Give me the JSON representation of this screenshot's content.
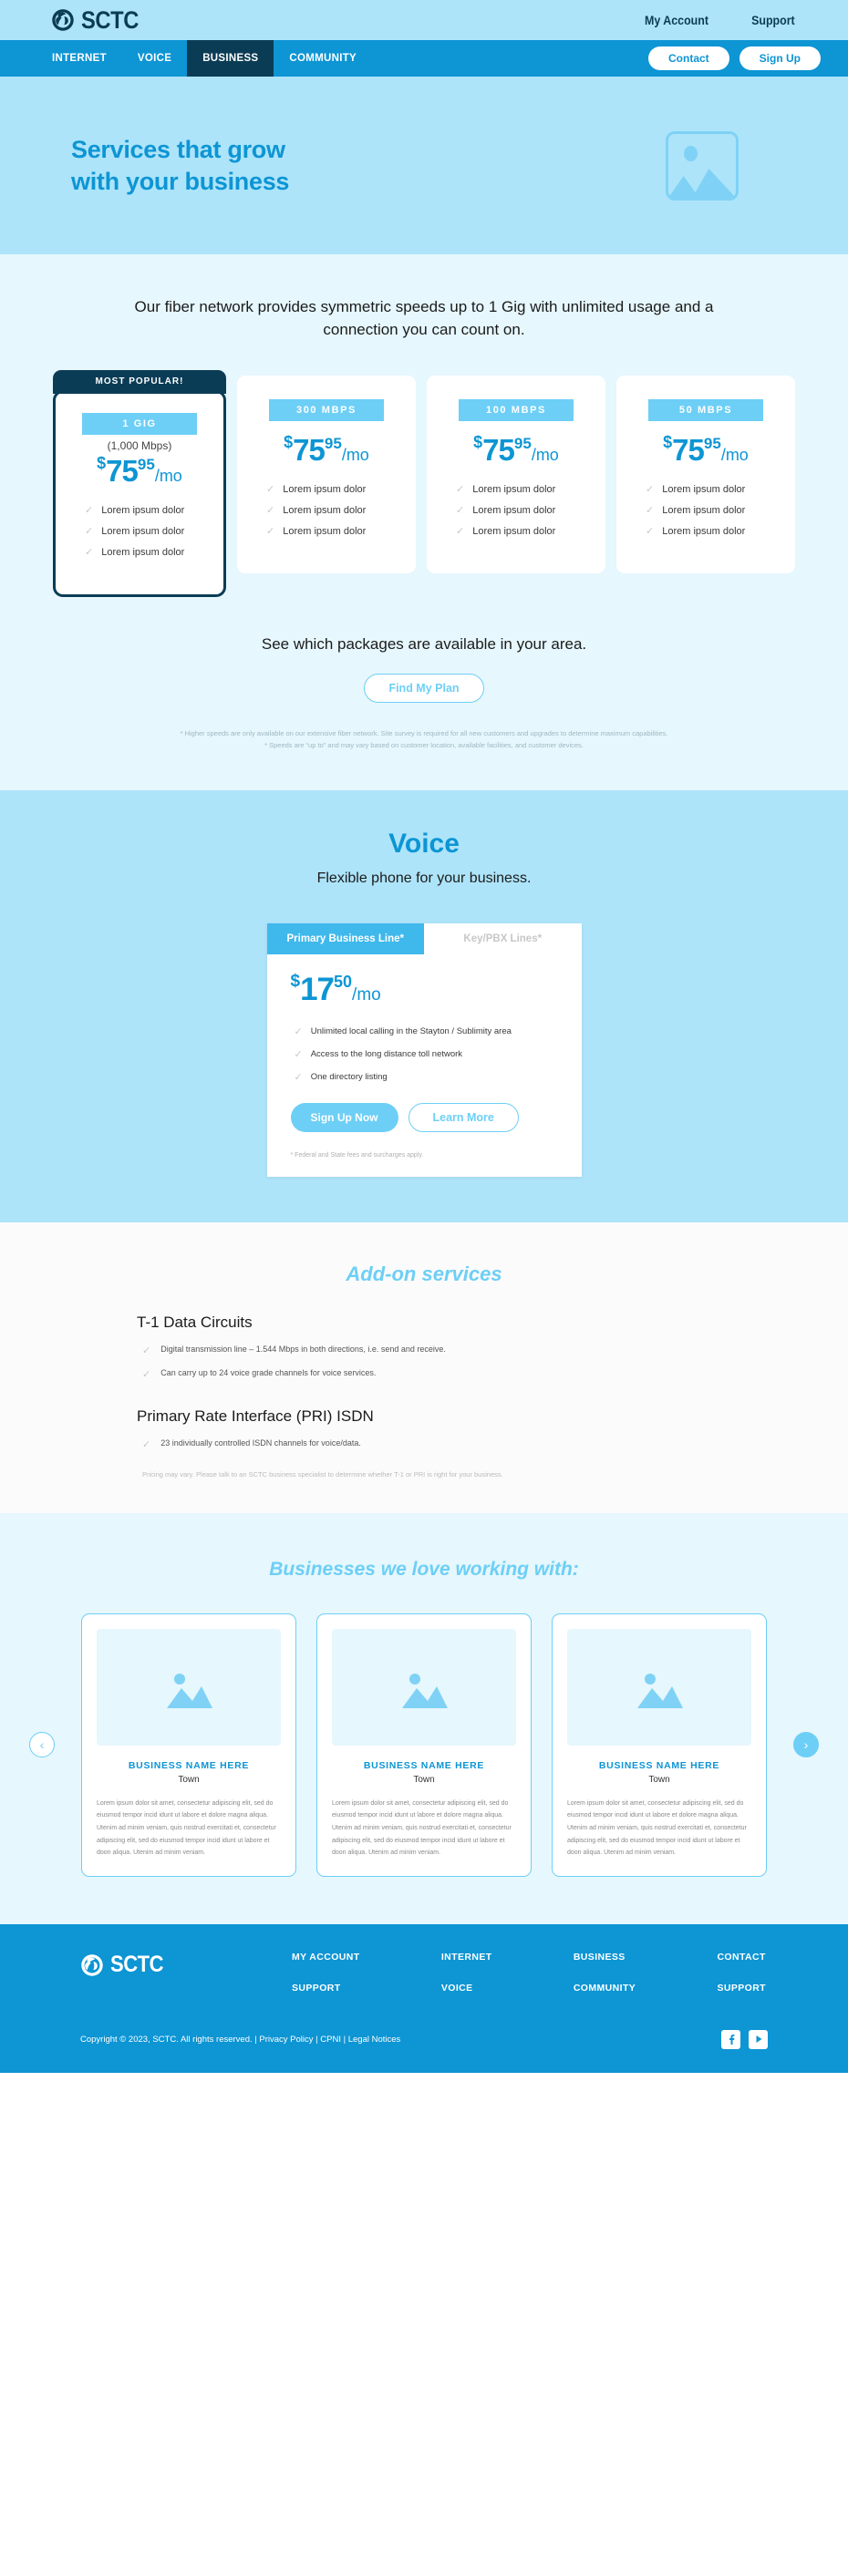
{
  "brand": {
    "name": "SCTC",
    "logo_icon": "sctc-swirl-logo"
  },
  "topbar": {
    "links": [
      {
        "label": "My Account"
      },
      {
        "label": "Support"
      }
    ]
  },
  "nav": {
    "items": [
      {
        "label": "INTERNET",
        "active": false
      },
      {
        "label": "VOICE",
        "active": false
      },
      {
        "label": "BUSINESS",
        "active": true
      },
      {
        "label": "COMMUNITY",
        "active": false
      }
    ],
    "contact_label": "Contact",
    "signup_label": "Sign Up"
  },
  "hero": {
    "title_line1": "Services that grow",
    "title_line2": "with your business",
    "image_icon": "image-placeholder-icon"
  },
  "pricing": {
    "lead": "Our fiber network provides symmetric speeds up to 1 Gig with unlimited usage and a connection you can count on.",
    "most_popular_label": "MOST POPULAR!",
    "cards": [
      {
        "speed": "1 GIG",
        "sub": "(1,000 Mbps)",
        "currency": "$",
        "amount": "75",
        "cents": "95",
        "per": "/mo",
        "features": [
          "Lorem ipsum dolor",
          "Lorem ipsum dolor",
          "Lorem ipsum dolor"
        ],
        "featured": true
      },
      {
        "speed": "300 MBPS",
        "sub": "",
        "currency": "$",
        "amount": "75",
        "cents": "95",
        "per": "/mo",
        "features": [
          "Lorem ipsum dolor",
          "Lorem ipsum dolor",
          "Lorem ipsum dolor"
        ],
        "featured": false
      },
      {
        "speed": "100 MBPS",
        "sub": "",
        "currency": "$",
        "amount": "75",
        "cents": "95",
        "per": "/mo",
        "features": [
          "Lorem ipsum dolor",
          "Lorem ipsum dolor",
          "Lorem ipsum dolor"
        ],
        "featured": false
      },
      {
        "speed": "50 MBPS",
        "sub": "",
        "currency": "$",
        "amount": "75",
        "cents": "95",
        "per": "/mo",
        "features": [
          "Lorem ipsum dolor",
          "Lorem ipsum dolor",
          "Lorem ipsum dolor"
        ],
        "featured": false
      }
    ],
    "availability_text": "See which packages are available in your area.",
    "find_plan_label": "Find My Plan",
    "footnote1": "* Higher speeds are only available on our extensive fiber network. Site survey is required for all new customers and upgrades to determine maximum capabilities.",
    "footnote2": "* Speeds are “up to” and may vary based on customer location, available facilities, and customer devices."
  },
  "voice": {
    "title": "Voice",
    "subtitle": "Flexible phone for your business.",
    "tabs": [
      {
        "label": "Primary Business Line*",
        "active": true
      },
      {
        "label": "Key/PBX Lines*",
        "active": false
      }
    ],
    "currency": "$",
    "amount": "17",
    "cents": "50",
    "per": "/mo",
    "features": [
      "Unlimited local calling in the Stayton / Sublimity area",
      "Access to the long distance toll network",
      "One directory listing"
    ],
    "signup_label": "Sign Up Now",
    "learnmore_label": "Learn More",
    "note": "* Federal and State fees and surcharges apply."
  },
  "addon": {
    "title": "Add-on services",
    "groups": [
      {
        "heading": "T-1 Data Circuits",
        "items": [
          "Digital transmission line – 1.544 Mbps in both directions, i.e. send and receive.",
          "Can carry up to 24 voice grade channels for voice services."
        ]
      },
      {
        "heading": "Primary Rate Interface (PRI) ISDN",
        "items": [
          "23 individually controlled ISDN channels for voice/data."
        ]
      }
    ],
    "note": "Pricing may vary. Please talk to an SCTC business specialist to determine whether T-1 or PRI is right for your business."
  },
  "testimonials": {
    "title": "Businesses we love working with:",
    "prev_icon": "chevron-left-icon",
    "next_icon": "chevron-right-icon",
    "cards": [
      {
        "name": "BUSINESS NAME HERE",
        "town": "Town",
        "body": "Lorem ipsum dolor sit amet, consectetur adipiscing elit, sed do eiusmod tempor incid idunt ut labore et dolore magna aliqua. Utenim ad minim veniam, quis nostrud exercitati et, consectetur adipiscing elit, sed do eiusmod tempor incid idunt ut labore et doon aliqua. Utenim ad minim veniam."
      },
      {
        "name": "BUSINESS NAME HERE",
        "town": "Town",
        "body": "Lorem ipsum dolor sit amet, consectetur adipiscing elit, sed do eiusmod tempor incid idunt ut labore et dolore magna aliqua. Utenim ad minim veniam, quis nostrud exercitati et, consectetur adipiscing elit, sed do eiusmod tempor incid idunt ut labore et doon aliqua. Utenim ad minim veniam."
      },
      {
        "name": "BUSINESS NAME HERE",
        "town": "Town",
        "body": "Lorem ipsum dolor sit amet, consectetur adipiscing elit, sed do eiusmod tempor incid idunt ut labore et dolore magna aliqua. Utenim ad minim veniam, quis nostrud exercitati et, consectetur adipiscing elit, sed do eiusmod tempor incid idunt ut labore et doon aliqua. Utenim ad minim veniam."
      }
    ]
  },
  "footer": {
    "columns": [
      {
        "top": "MY ACCOUNT",
        "bottom": "SUPPORT"
      },
      {
        "top": "INTERNET",
        "bottom": "VOICE"
      },
      {
        "top": "BUSINESS",
        "bottom": "COMMUNITY"
      },
      {
        "top": "CONTACT",
        "bottom": "SUPPORT"
      }
    ],
    "copyright": "Copyright © 2023, SCTC. All rights reserved.",
    "sep": " | ",
    "privacy": "Privacy Policy",
    "cpni": "CPNI",
    "legal": "Legal Notices",
    "social": [
      {
        "icon": "facebook-icon"
      },
      {
        "icon": "youtube-icon"
      }
    ]
  },
  "colors": {
    "brand_blue": "#0d95d4",
    "dark_navy": "#0b3c55",
    "light_blue": "#6dcff6",
    "hero_bg": "#ade4fa",
    "pale_bg": "#e6f7fd"
  }
}
